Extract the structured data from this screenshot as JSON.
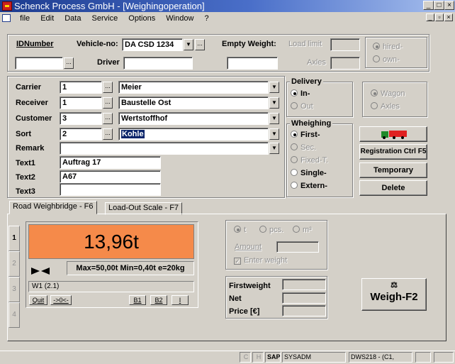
{
  "window": {
    "title": "Schenck Process GmbH - [Weighingoperation]",
    "min_glyph": "_",
    "max_glyph": "□",
    "close_glyph": "×"
  },
  "menu": {
    "items": [
      "file",
      "Edit",
      "Data",
      "Service",
      "Options",
      "Window",
      "?"
    ],
    "mdi_min": "_",
    "mdi_restore": "▫",
    "mdi_close": "×"
  },
  "header": {
    "idnumber_label": "IDNumber",
    "idnumber_value": "",
    "vehicle_label": "Vehicle-no:",
    "vehicle_value": "DA CSD 1234",
    "driver_label": "Driver",
    "driver_value": "",
    "empty_weight_label": "Empty Weight:",
    "empty_weight_value": "",
    "load_limit_label": "Load limit",
    "load_limit_value": "",
    "axles_label": "Axles",
    "axles_value": "",
    "ownership": [
      "hired-",
      "own-"
    ],
    "ownership_selected": 0,
    "dots": "..."
  },
  "form": {
    "rows": [
      {
        "label": "Carrier",
        "code": "1",
        "value": "Meier"
      },
      {
        "label": "Receiver",
        "code": "1",
        "value": "Baustelle Ost"
      },
      {
        "label": "Customer",
        "code": "3",
        "value": "Wertstoffhof"
      },
      {
        "label": "Sort",
        "code": "2",
        "value": "Kohle"
      },
      {
        "label": "Remark",
        "code": "",
        "value": ""
      }
    ],
    "texts": [
      {
        "label": "Text1",
        "value": "Auftrag 17"
      },
      {
        "label": "Text2",
        "value": "A67"
      },
      {
        "label": "Text3",
        "value": ""
      }
    ],
    "dropdown_glyph": "▼"
  },
  "delivery": {
    "title": "Delivery",
    "options": [
      "In-",
      "Out"
    ],
    "selected": 0
  },
  "weighing": {
    "title": "Wheighing",
    "options": [
      "First-",
      "Sec.",
      "Fixed-T.",
      "Single-",
      "Extern-"
    ],
    "selected": 0
  },
  "wagon_group": {
    "options": [
      "Wagon",
      "Axles"
    ],
    "selected": 0
  },
  "buttons": {
    "registration": "Registration Ctrl F5",
    "temporary": "Temporary",
    "delete": "Delete",
    "weigh": "Weigh-F2"
  },
  "tabs": [
    "Road Weighbridge - F6",
    "Load-Out Scale - F7"
  ],
  "scale": {
    "side_numbers": [
      "1",
      "2",
      "3",
      "4"
    ],
    "reading": "13,96t",
    "spec": "Max=50,00t Min=0,40t e=20kg",
    "name": "W1 (2.1)",
    "small_buttons": [
      "Quit",
      "->0<-",
      "B1",
      "B2",
      "I"
    ],
    "display_color": "#f58a4a"
  },
  "units": {
    "options": [
      "t",
      "pcs.",
      "m³"
    ],
    "selected": 0,
    "amount_label": "Amount",
    "amount_value": "",
    "enter_weight_label": "Enter weight",
    "enter_weight_checked": true
  },
  "results": {
    "firstweight_label": "Firstweight",
    "firstweight_value": "",
    "net_label": "Net",
    "net_value": "",
    "price_label": "Price [€]",
    "price_value": ""
  },
  "statusbar": {
    "cells": [
      "C",
      "H",
      "SAP",
      "SYSADM",
      "DWS218 - (C1,",
      "",
      ""
    ]
  }
}
